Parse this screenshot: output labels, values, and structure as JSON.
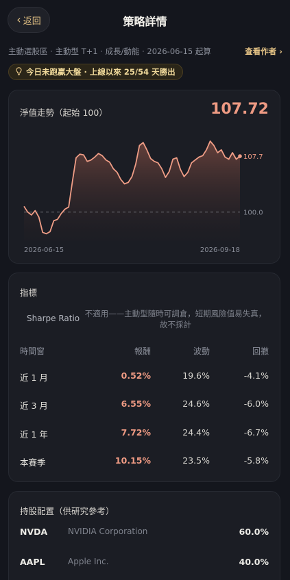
{
  "nav": {
    "back_label": "返回",
    "title": "策略詳情"
  },
  "meta": {
    "summary": "主動選股區 · 主動型 T+1 · 成長/動能 · 2026-06-15 起算",
    "author_link": "查看作者 ›"
  },
  "banner": {
    "text": "今日未跑贏大盤 · 上線以來 25/54 天勝出"
  },
  "chart_card": {
    "title": "淨值走勢（起始 100）",
    "current_value": "107.72"
  },
  "chart_data": {
    "type": "area",
    "title": "淨值走勢（起始 100）",
    "baseline": 100.0,
    "baseline_label": "100.0",
    "last_label": "107.7",
    "x_start_label": "2026-06-15",
    "x_end_label": "2026-09-18",
    "ylim": [
      96.0,
      110.0
    ],
    "values": [
      100.8,
      100.0,
      99.6,
      100.2,
      99.3,
      97.2,
      97.0,
      97.3,
      98.8,
      99.0,
      99.8,
      100.4,
      100.7,
      104.2,
      107.5,
      108.0,
      107.9,
      107.0,
      107.2,
      107.6,
      108.1,
      107.8,
      107.2,
      106.9,
      106.0,
      105.5,
      104.5,
      103.9,
      104.1,
      104.9,
      106.6,
      109.2,
      109.6,
      108.6,
      107.4,
      107.0,
      106.8,
      106.0,
      104.8,
      105.6,
      107.3,
      107.5,
      105.9,
      104.9,
      105.5,
      106.8,
      107.2,
      107.6,
      107.8,
      108.6,
      109.8,
      109.2,
      108.2,
      108.6,
      107.6,
      107.3,
      108.2,
      107.3,
      107.72
    ],
    "line_color": "#ef9d86",
    "grid": false
  },
  "metrics": {
    "title": "指標",
    "sharpe_label": "Sharpe Ratio",
    "sharpe_note": "不適用——主動型隨時可調倉，短期風險值易失真，故不採計",
    "headers": {
      "window": "時間窗",
      "return": "報酬",
      "volatility": "波動",
      "drawdown": "回撤"
    },
    "rows": [
      {
        "window": "近 1 月",
        "return": "0.52%",
        "volatility": "19.6%",
        "drawdown": "-4.1%"
      },
      {
        "window": "近 3 月",
        "return": "6.55%",
        "volatility": "24.6%",
        "drawdown": "-6.0%"
      },
      {
        "window": "近 1 年",
        "return": "7.72%",
        "volatility": "24.4%",
        "drawdown": "-6.7%"
      },
      {
        "window": "本賽季",
        "return": "10.15%",
        "volatility": "23.5%",
        "drawdown": "-5.8%"
      }
    ]
  },
  "holdings": {
    "title": "持股配置（供研究參考）",
    "items": [
      {
        "ticker": "NVDA",
        "name": "NVIDIA Corporation",
        "weight": "60.0%"
      },
      {
        "ticker": "AAPL",
        "name": "Apple Inc.",
        "weight": "40.0%"
      }
    ]
  },
  "colors": {
    "accent_gold": "#e6c486",
    "accent_salmon": "#ee9a83",
    "background": "#14161d"
  }
}
